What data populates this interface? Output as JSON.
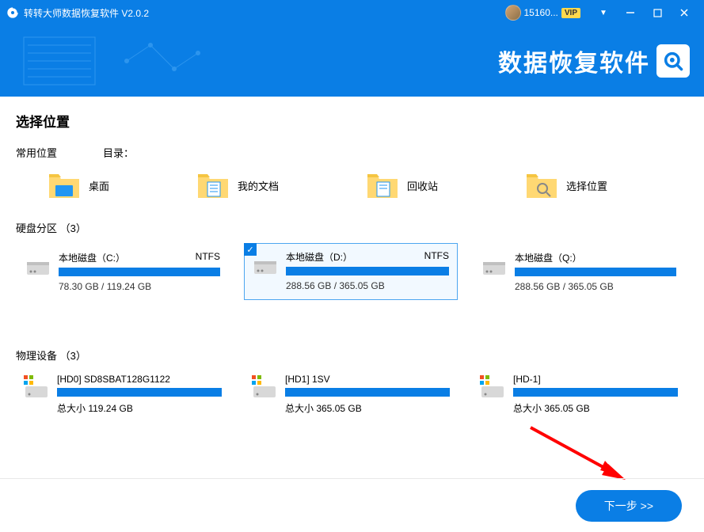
{
  "titlebar": {
    "title": "转转大师数据恢复软件 V2.0.2",
    "username": "15160...",
    "vip": "VIP"
  },
  "banner": {
    "brand": "数据恢复软件"
  },
  "main": {
    "title": "选择位置",
    "common_label": "常用位置",
    "directory_label": "目录：",
    "locations": [
      {
        "label": "桌面"
      },
      {
        "label": "我的文档"
      },
      {
        "label": "回收站"
      },
      {
        "label": "选择位置"
      }
    ],
    "partition_title": "硬盘分区 （3）",
    "partitions": [
      {
        "name": "本地磁盘（C:）",
        "fs": "NTFS",
        "size": "78.30 GB / 119.24 GB",
        "selected": false
      },
      {
        "name": "本地磁盘（D:）",
        "fs": "NTFS",
        "size": "288.56 GB / 365.05 GB",
        "selected": true
      },
      {
        "name": "本地磁盘（Q:）",
        "fs": "",
        "size": "288.56 GB / 365.05 GB",
        "selected": false
      }
    ],
    "device_title": "物理设备 （3）",
    "devices": [
      {
        "name": "[HD0] SD8SBAT128G1122",
        "size": "总大小 119.24 GB"
      },
      {
        "name": "[HD1] 1SV",
        "size": "总大小 365.05 GB"
      },
      {
        "name": "[HD-1]",
        "size": "总大小 365.05 GB"
      }
    ]
  },
  "footer": {
    "next": "下一步 >>"
  }
}
